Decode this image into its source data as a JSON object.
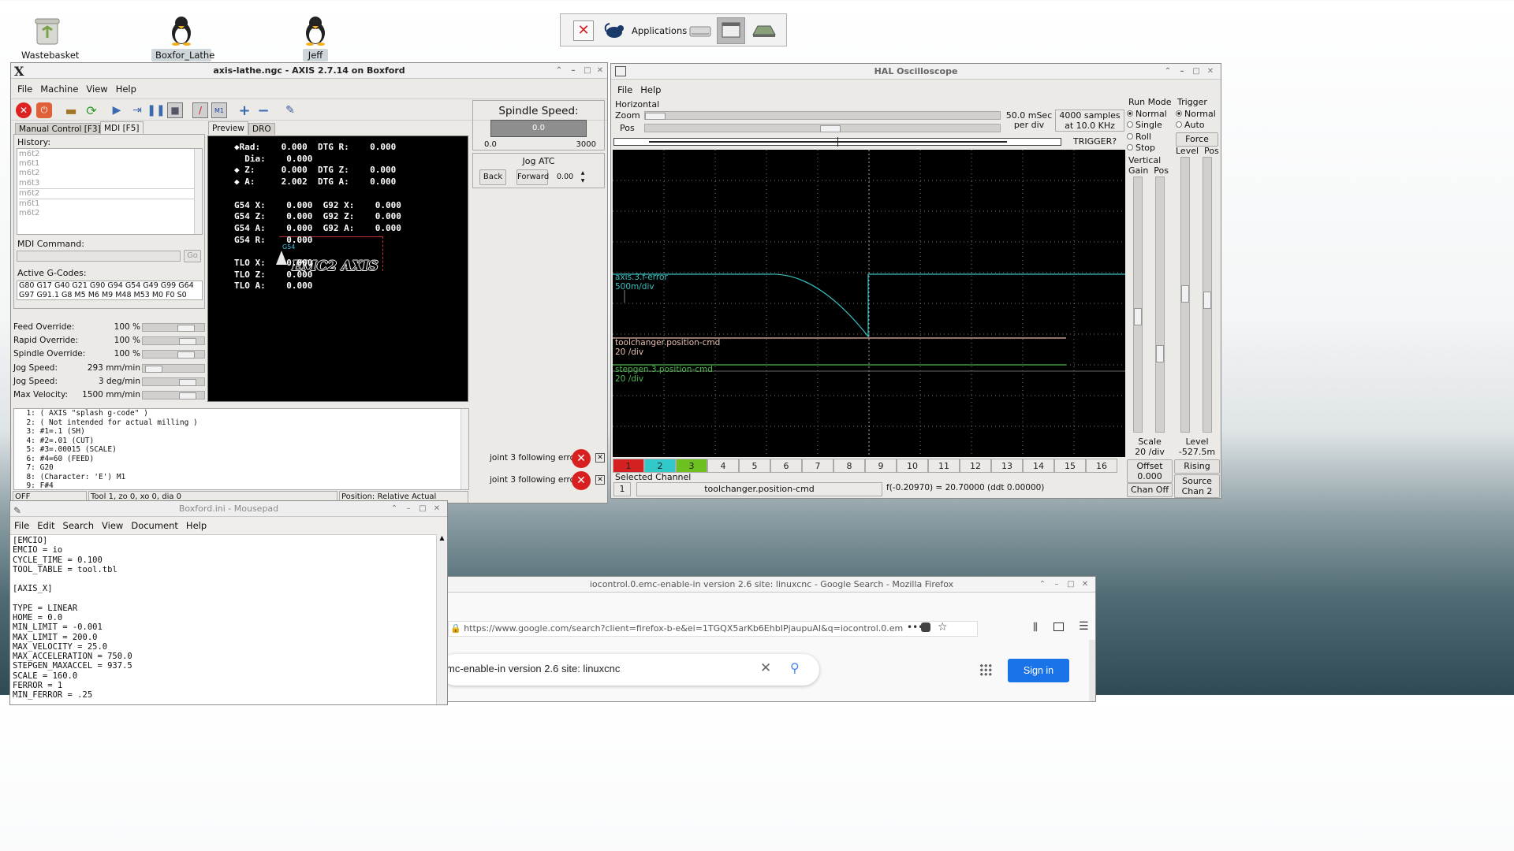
{
  "desktop": {
    "icons": [
      "Wastebasket",
      "Boxfor_Lathe",
      "Jeff"
    ]
  },
  "panel": {
    "applications": "Applications"
  },
  "axis": {
    "title": "axis-lathe.ngc - AXIS 2.7.14 on Boxford",
    "menu": [
      "File",
      "Machine",
      "View",
      "Help"
    ],
    "tabs": [
      "Manual Control [F3]",
      "MDI [F5]"
    ],
    "view_tabs": [
      "Preview",
      "DRO"
    ],
    "history_label": "History:",
    "history": [
      "m6t2",
      "m6t1",
      "m6t2",
      "m6t3",
      "m6t2",
      "m6t1",
      "m6t2"
    ],
    "mdi_label": "MDI Command:",
    "go": "Go",
    "active_gcodes_label": "Active G-Codes:",
    "gcodes_line1": "G80 G17 G40 G21 G90 G94 G54 G49 G99 G64",
    "gcodes_line2": "G97 G91.1 G8 M5 M6 M9 M48 M53 M0 F0 S0",
    "overrides": [
      {
        "label": "Feed Override:",
        "value": "100 %",
        "level": 0.75
      },
      {
        "label": "Rapid Override:",
        "value": "100 %",
        "level": 0.8
      },
      {
        "label": "Spindle Override:",
        "value": "100 %",
        "level": 0.75
      },
      {
        "label": "Jog Speed:",
        "value": "293 mm/min",
        "level": 0.05
      },
      {
        "label": "Jog Speed:",
        "value": "3 deg/min",
        "level": 0.8
      },
      {
        "label": "Max Velocity:",
        "value": "1500 mm/min",
        "level": 0.8
      }
    ],
    "dro": [
      "◆Rad:    0.000  DTG R:    0.000",
      "  Dia:    0.000",
      "◆ Z:     0.000  DTG Z:    0.000",
      "◆ A:     2.002  DTG A:    0.000",
      "",
      "G54 X:    0.000  G92 X:    0.000",
      "G54 Z:    0.000  G92 Z:    0.000",
      "G54 A:    0.000  G92 A:    0.000",
      "G54 R:    0.000",
      "",
      "TLO X:    0.000",
      "TLO Z:    0.000",
      "TLO A:    0.000"
    ],
    "splash": "EMC2 AXIS",
    "g54_label": "G54",
    "spindle_speed_label": "Spindle Speed:",
    "spindle_value": "0.0",
    "spindle_min": "0.0",
    "spindle_max": "3000",
    "jog_atc_label": "Jog ATC",
    "back": "Back",
    "forward": "Forward",
    "atc_value": "0.00",
    "gcode_lines": [
      "  1: ( AXIS \"splash g-code\" )",
      "  2: ( Not intended for actual milling )",
      "  3: #1=.1 (SH)",
      "  4: #2=.01 (CUT)",
      "  5: #3=.00015 (SCALE)",
      "  6: #4=60 (FEED)",
      "  7: G20",
      "  8: (Character: 'E') M1",
      "  9: F#4"
    ],
    "errors": [
      "joint 3 following error",
      "joint 3 following error"
    ],
    "status": [
      "OFF",
      "Tool 1, zo 0, xo 0, dia 0",
      "Position: Relative Actual"
    ]
  },
  "scope": {
    "title": "HAL Oscilloscope",
    "menu": [
      "File",
      "Help"
    ],
    "horizontal": "Horizontal",
    "zoom": "Zoom",
    "pos": "Pos",
    "rate1": "50.0 mSec",
    "rate2": "per div",
    "samples1": "4000 samples",
    "samples2": "at 10.0 KHz",
    "trigger_q": "TRIGGER?",
    "run_mode": "Run Mode",
    "run_modes": [
      "Normal",
      "Single",
      "Roll",
      "Stop"
    ],
    "trigger": "Trigger",
    "trigger_modes": [
      "Normal",
      "Auto"
    ],
    "force": "Force",
    "level": "Level",
    "pos_lbl": "Pos",
    "vertical": "Vertical",
    "gain": "Gain",
    "vpos": "Pos",
    "traces": [
      {
        "name": "axis.3.f-error",
        "scale": "500m/div",
        "color": "#39c0c0"
      },
      {
        "name": "toolchanger.position-cmd",
        "scale": "20 /div",
        "color": "#e8b8a8"
      },
      {
        "name": "stepgen.3.position-cmd",
        "scale": "20 /div",
        "color": "#4cb84c"
      }
    ],
    "channels": [
      "1",
      "2",
      "3",
      "4",
      "5",
      "6",
      "7",
      "8",
      "9",
      "10",
      "11",
      "12",
      "13",
      "14",
      "15",
      "16"
    ],
    "channel_colors": [
      "#d42020",
      "#30c8c8",
      "#6cc020"
    ],
    "scale_label": "Scale",
    "scale_value": "20 /div",
    "offset_label": "Offset",
    "offset_value": "0.000",
    "chan_off": "Chan Off",
    "level_label": "Level",
    "level_value": "-527.5m",
    "rising": "Rising",
    "source_label": "Source",
    "source_value": "Chan  2",
    "selected_channel": "Selected Channel",
    "sel_num": "1",
    "sel_name": "toolchanger.position-cmd",
    "readout": "f(-0.20970) =  20.70000 (ddt  0.00000)"
  },
  "mousepad": {
    "title": "Boxford.ini - Mousepad",
    "menu": [
      "File",
      "Edit",
      "Search",
      "View",
      "Document",
      "Help"
    ],
    "lines": [
      "[EMCIO]",
      "EMCIO = io",
      "CYCLE_TIME = 0.100",
      "TOOL_TABLE = tool.tbl",
      "",
      "[AXIS_X]",
      "",
      "TYPE = LINEAR",
      "HOME = 0.0",
      "MIN_LIMIT = -0.001",
      "MAX_LIMIT = 200.0",
      "MAX_VELOCITY = 25.0",
      "MAX_ACCELERATION = 750.0",
      "STEPGEN_MAXACCEL = 937.5",
      "SCALE = 160.0",
      "FERROR = 1",
      "MIN_FERROR = .25"
    ]
  },
  "firefox": {
    "title": "iocontrol.0.emc-enable-in version 2.6 site: linuxcnc - Google Search - Mozilla Firefox",
    "url": "https://www.google.com/search?client=firefox-b-e&ei=1TGQX5arKb6EhbIPjaupuAI&q=iocontrol.0.em",
    "search": "mc-enable-in  version 2.6 site: linuxcnc",
    "sign_in": "Sign in"
  }
}
